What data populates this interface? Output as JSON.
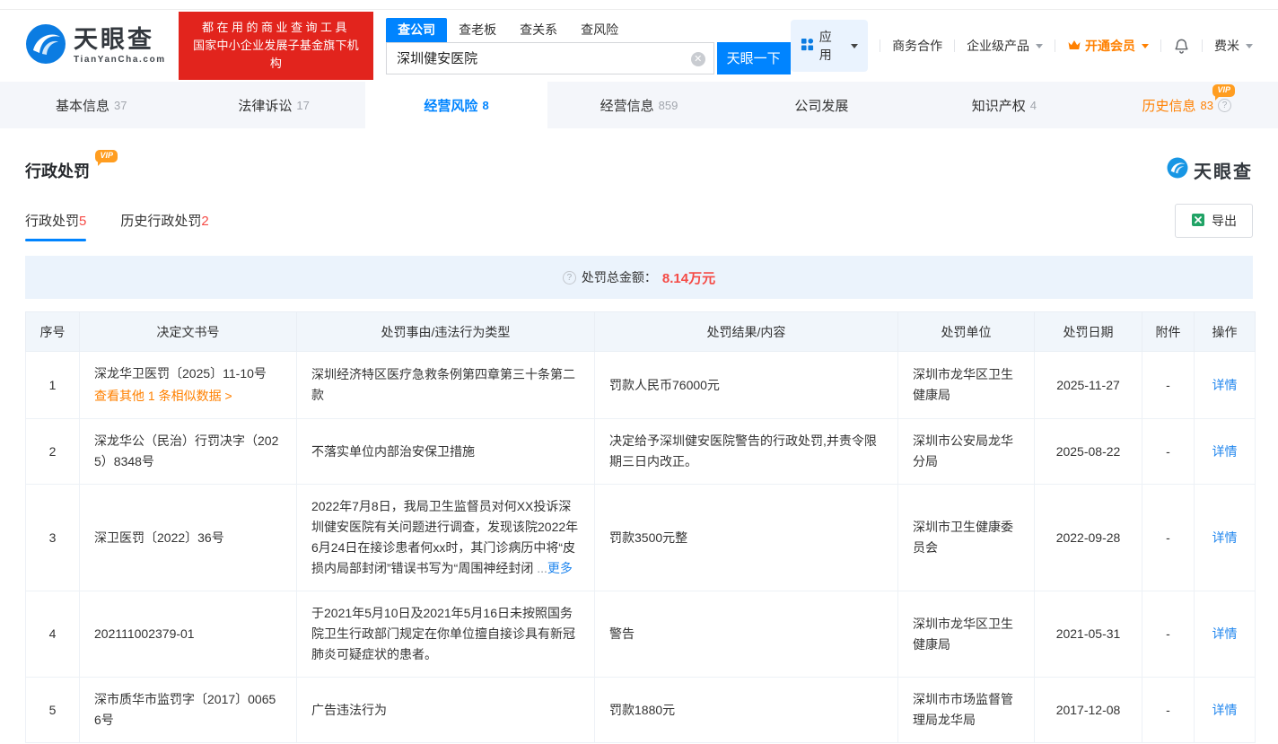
{
  "header": {
    "logo": {
      "title": "天眼查",
      "subtitle": "TianYanCha.com"
    },
    "slogan": {
      "line1": "都在用的商业查询工具",
      "line2": "国家中小企业发展子基金旗下机构"
    },
    "search": {
      "tabs": [
        {
          "label": "查公司",
          "active": true
        },
        {
          "label": "查老板",
          "active": false
        },
        {
          "label": "查关系",
          "active": false
        },
        {
          "label": "查风险",
          "active": false
        }
      ],
      "value": "深圳健安医院",
      "button_label": "天眼一下"
    },
    "nav": {
      "apps_label": "应用",
      "cooperation_label": "商务合作",
      "products_label": "企业级产品",
      "vip_label": "开通会员",
      "user_label": "费米"
    }
  },
  "company_tabs": [
    {
      "label": "基本信息",
      "count": "37",
      "active": false,
      "vip": false,
      "help": false
    },
    {
      "label": "法律诉讼",
      "count": "17",
      "active": false,
      "vip": false,
      "help": false
    },
    {
      "label": "经营风险",
      "count": "8",
      "active": true,
      "vip": false,
      "help": false
    },
    {
      "label": "经营信息",
      "count": "859",
      "active": false,
      "vip": false,
      "help": false
    },
    {
      "label": "公司发展",
      "count": "",
      "active": false,
      "vip": false,
      "help": false
    },
    {
      "label": "知识产权",
      "count": "4",
      "active": false,
      "vip": false,
      "help": false
    },
    {
      "label": "历史信息",
      "count": "83",
      "active": false,
      "vip": true,
      "help": true
    }
  ],
  "section": {
    "title": "行政处罚",
    "vip_badge": "VIP",
    "watermark": "天眼查",
    "subtabs": [
      {
        "label": "行政处罚",
        "count": "5",
        "active": true
      },
      {
        "label": "历史行政处罚",
        "count": "2",
        "active": false
      }
    ],
    "export_label": "导出",
    "summary_label": "处罚总金额：",
    "summary_value": "8.14万元"
  },
  "table": {
    "headers": [
      "序号",
      "决定文书号",
      "处罚事由/违法行为类型",
      "处罚结果/内容",
      "处罚单位",
      "处罚日期",
      "附件",
      "操作"
    ],
    "rows": [
      {
        "seq": "1",
        "doc_no": "深龙华卫医罚〔2025〕11-10号",
        "doc_link": "查看其他 1 条相似数据 >",
        "reason": "深圳经济特区医疗急救条例第四章第三十条第二款",
        "reason_truncated": false,
        "reason_ellipsis": "",
        "more_label": "",
        "result": "罚款人民币76000元",
        "unit": "深圳市龙华区卫生健康局",
        "date": "2025-11-27",
        "attachment": "-",
        "action": "详情"
      },
      {
        "seq": "2",
        "doc_no": "深龙华公（民治）行罚决字（2025）8348号",
        "doc_link": "",
        "reason": "不落实单位内部治安保卫措施",
        "reason_truncated": false,
        "reason_ellipsis": "",
        "more_label": "",
        "result": "决定给予深圳健安医院警告的行政处罚,并责令限期三日内改正。",
        "unit": "深圳市公安局龙华分局",
        "date": "2025-08-22",
        "attachment": "-",
        "action": "详情"
      },
      {
        "seq": "3",
        "doc_no": "深卫医罚〔2022〕36号",
        "doc_link": "",
        "reason": "2022年7月8日，我局卫生监督员对何XX投诉深圳健安医院有关问题进行调查，发现该院2022年6月24日在接诊患者何xx时，其门诊病历中将“皮损内局部封闭”错误书写为“周围神经封闭",
        "reason_truncated": true,
        "reason_ellipsis": " ...",
        "more_label": "更多",
        "result": "罚款3500元整",
        "unit": "深圳市卫生健康委员会",
        "date": "2022-09-28",
        "attachment": "-",
        "action": "详情"
      },
      {
        "seq": "4",
        "doc_no": "202111002379-01",
        "doc_link": "",
        "reason": "于2021年5月10日及2021年5月16日未按照国务院卫生行政部门规定在你单位擅自接诊具有新冠肺炎可疑症状的患者。",
        "reason_truncated": false,
        "reason_ellipsis": "",
        "more_label": "",
        "result": "警告",
        "unit": "深圳市龙华区卫生健康局",
        "date": "2021-05-31",
        "attachment": "-",
        "action": "详情"
      },
      {
        "seq": "5",
        "doc_no": "深市质华市监罚字〔2017〕00656号",
        "doc_link": "",
        "reason": "广告违法行为",
        "reason_truncated": false,
        "reason_ellipsis": "",
        "more_label": "",
        "result": "罚款1880元",
        "unit": "深圳市市场监督管理局龙华局",
        "date": "2017-12-08",
        "attachment": "-",
        "action": "详情"
      }
    ]
  },
  "colors": {
    "primary_blue": "#0084ff",
    "link_blue": "#2086ee",
    "brand_red": "#e2241d",
    "alert_red": "#f54a45",
    "vip_orange": "#ff8000"
  }
}
